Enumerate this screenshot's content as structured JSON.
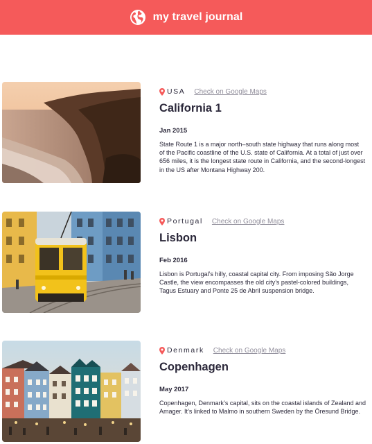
{
  "header": {
    "title": "my travel journal",
    "icon": "globe-icon",
    "background": "#f55a5a"
  },
  "entries": [
    {
      "photo": "california-coast-photo",
      "location": "USA",
      "maps_link": "Check on Google Maps",
      "title": "California 1",
      "dates": "Jan 2015",
      "description": "State Route 1 is a major north–south state highway that runs along most of the Pacific coastline of the U.S. state of California. At a total of just over 656 miles, it is the longest state route in California, and the second-longest in the US after Montana Highway 200."
    },
    {
      "photo": "lisbon-tram-photo",
      "location": "Portugal",
      "maps_link": "Check on Google Maps",
      "title": "Lisbon",
      "dates": "Feb 2016",
      "description": "Lisbon is Portugal’s hilly, coastal capital city. From imposing São Jorge Castle, the view encompasses the old city’s pastel-colored buildings, Tagus Estuary and Ponte 25 de Abril suspension bridge."
    },
    {
      "photo": "copenhagen-nyhavn-photo",
      "location": "Denmark",
      "maps_link": "Check on Google Maps",
      "title": "Copenhagen",
      "dates": "May 2017",
      "description": "Copenhagen, Denmark’s capital, sits on the coastal islands of Zealand and Amager. It’s linked to Malmo in southern Sweden by the Öresund Bridge."
    }
  ],
  "colors": {
    "accent": "#f55a5a",
    "link": "#918e9b",
    "text": "#2b283a"
  }
}
